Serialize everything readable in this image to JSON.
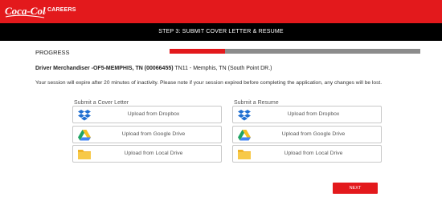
{
  "header": {
    "brand": "Coca-Cola",
    "section_label": "CAREERS",
    "brand_color": "#e3191c"
  },
  "stepbar": {
    "text": "STEP 3: SUBMIT COVER LETTER & RESUME"
  },
  "progress": {
    "label": "PROGRESS",
    "fraction": 0.22
  },
  "job": {
    "title": "Driver Merchandiser -OF5-MEMPHIS, TN (00066455)",
    "location": "TN11 - Memphis, TN (South Point DR.)"
  },
  "notice": "Your session will expire after 20 minutes of inactivity. Please note if your session expired before completing the application, any changes will be lost.",
  "cover_letter": {
    "title": "Submit a Cover Letter",
    "options": [
      {
        "label": "Upload from Dropbox",
        "icon": "dropbox-icon"
      },
      {
        "label": "Upload from Google Drive",
        "icon": "google-drive-icon"
      },
      {
        "label": "Upload from Local Drive",
        "icon": "folder-icon"
      }
    ]
  },
  "resume": {
    "title": "Submit a Resume",
    "options": [
      {
        "label": "Upload from Dropbox",
        "icon": "dropbox-icon"
      },
      {
        "label": "Upload from Google Drive",
        "icon": "google-drive-icon"
      },
      {
        "label": "Upload from Local Drive",
        "icon": "folder-icon"
      }
    ]
  },
  "next_label": "NEXT"
}
